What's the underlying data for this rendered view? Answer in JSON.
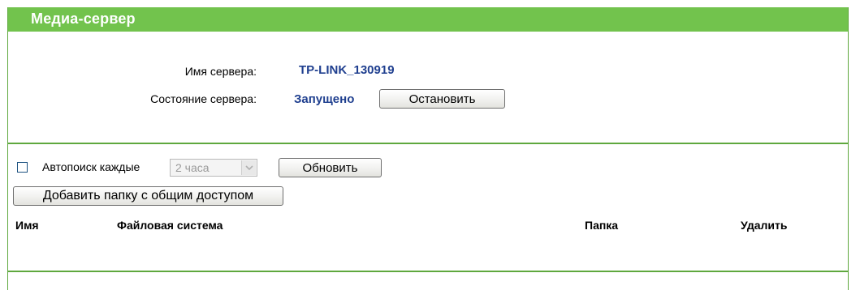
{
  "header": {
    "title": "Медиа-сервер"
  },
  "server": {
    "name_label": "Имя сервера:",
    "name_value": "TP-LINK_130919",
    "status_label": "Состояние сервера:",
    "status_value": "Запущено",
    "stop_button": "Остановить"
  },
  "scan": {
    "checked": false,
    "label": "Автопоиск каждые",
    "interval_selected": "2 часа",
    "refresh_button": "Обновить"
  },
  "share": {
    "add_button": "Добавить папку с общим доступом"
  },
  "table": {
    "columns": [
      "Имя",
      "Файловая система",
      "Папка",
      "Удалить"
    ]
  },
  "colors": {
    "header_bg": "#72c34d",
    "accent_border": "#5fa83e",
    "value_text": "#1f3f8f"
  }
}
